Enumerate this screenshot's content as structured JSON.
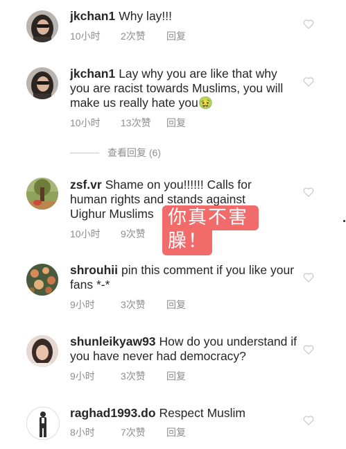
{
  "comments": [
    {
      "username": "jkchan1",
      "text": "Why lay!!!",
      "time": "10小时",
      "likes": "2次赞",
      "reply": "回复",
      "avatar": "woman-sunglasses-avatar"
    },
    {
      "username": "jkchan1",
      "text": "Lay why you are like that why you are racist towards Muslims, you will make us really hate you🤢",
      "time": "10小时",
      "likes": "13次赞",
      "reply": "回复",
      "avatar": "woman-sunglasses-avatar"
    },
    {
      "username": "zsf.vr",
      "text": "Shame on you!!!!!! Calls for human rights and stands against Uighur Muslims",
      "time": "10小时",
      "likes": "9次赞",
      "reply": "回复",
      "avatar": "tree-landscape-avatar"
    },
    {
      "username": "shrouhii",
      "text": "pin this comment if you like your fans *-*",
      "time": "9小时",
      "likes": "3次赞",
      "reply": "回复",
      "avatar": "flowers-avatar"
    },
    {
      "username": "shunleikyaw93",
      "text": "How do you understand if you have never had democracy?",
      "time": "9小时",
      "likes": "3次赞",
      "reply": "回复",
      "avatar": "woman-portrait-avatar"
    },
    {
      "username": "raghad1993.do",
      "text": "Respect Muslim",
      "time": "8小时",
      "likes": "7次赞",
      "reply": "回复",
      "avatar": "man-suit-avatar"
    }
  ],
  "view_replies": "查看回复 (6)",
  "sticker": {
    "line1": "你真不害",
    "line2": "臊！",
    "color": "#f26b6b"
  },
  "colors": {
    "text": "#262626",
    "meta": "#8e8e8e",
    "heart": "#c7c7c7"
  }
}
